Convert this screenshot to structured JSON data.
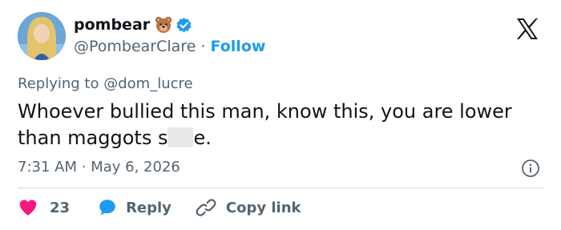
{
  "author": {
    "display_name": "pombear",
    "handle": "@PombearClare",
    "separator": "·",
    "follow_label": "Follow",
    "badge_icon": "bear-face-icon",
    "verified_color": "#1d9bf0"
  },
  "reply_to": {
    "prefix": "Replying to",
    "handle": "@dom_lucre"
  },
  "tweet": {
    "text_line1": "Whoever bullied this man, know this, you are lower",
    "text_line2_start": "than maggots s",
    "text_line2_end": "e."
  },
  "meta": {
    "time": "7:31 AM",
    "separator": "·",
    "date": "May 6, 2026"
  },
  "actions": {
    "like_count": "23",
    "reply_label": "Reply",
    "copy_label": "Copy link"
  },
  "colors": {
    "like": "#f91880",
    "reply": "#1d9bf0",
    "text_secondary": "#536471"
  }
}
